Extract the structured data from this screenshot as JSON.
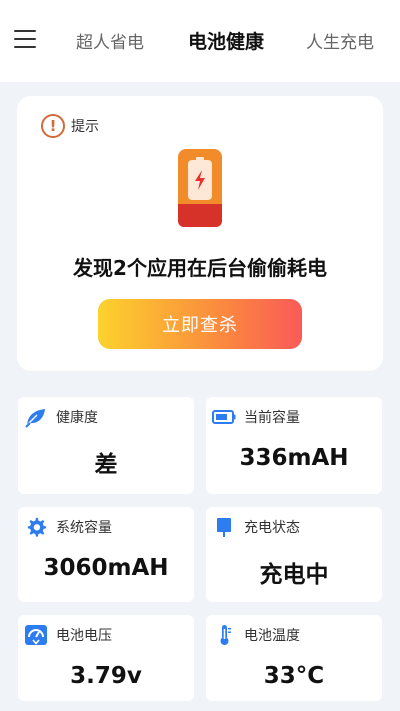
{
  "header": {
    "tabs": [
      {
        "label": "超人省电"
      },
      {
        "label": "电池健康"
      },
      {
        "label": "人生充电"
      }
    ]
  },
  "alert": {
    "tip_label": "提示",
    "tip_icon_glyph": "!",
    "message": "发现2个应用在后台偷偷耗电",
    "button_label": "立即查杀"
  },
  "stats": {
    "health": {
      "label": "健康度",
      "value": "差",
      "icon": "leaf-icon"
    },
    "current_capacity": {
      "label": "当前容量",
      "value": "336mAH",
      "icon": "battery-icon"
    },
    "system_capacity": {
      "label": "系统容量",
      "value": "3060mAH",
      "icon": "gear-icon"
    },
    "charge_status": {
      "label": "充电状态",
      "value": "充电中",
      "icon": "charger-icon"
    },
    "voltage": {
      "label": "电池电压",
      "value": "3.79v",
      "icon": "gauge-icon"
    },
    "temperature": {
      "label": "电池温度",
      "value": "33°C",
      "icon": "thermometer-icon"
    }
  },
  "colors": {
    "accent_blue": "#2d7cf0",
    "warning_orange": "#d06b3a",
    "button_gradient_start": "#fcd22d",
    "button_gradient_end": "#fa5a57"
  }
}
